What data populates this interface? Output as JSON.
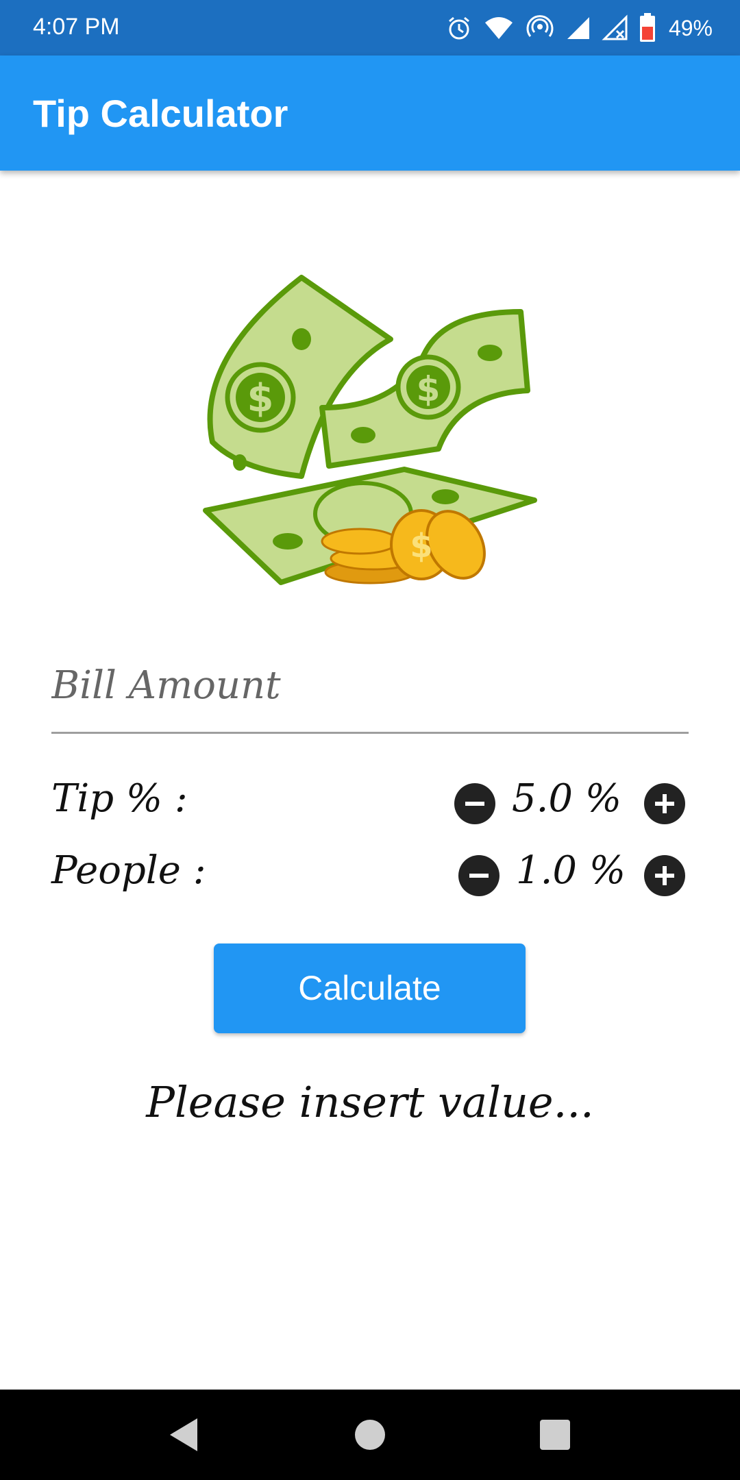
{
  "status_bar": {
    "time": "4:07 PM",
    "battery": "49%",
    "icons": [
      "alarm-icon",
      "wifi-icon",
      "hotspot-icon",
      "signal-icon",
      "signal-no-data-icon",
      "battery-icon"
    ]
  },
  "app_bar": {
    "title": "Tip Calculator"
  },
  "hero": {
    "image": "money-illustration"
  },
  "bill": {
    "placeholder": "Bill Amount",
    "value": ""
  },
  "tip": {
    "label": "Tip % :",
    "value": "5.0 %"
  },
  "people": {
    "label": "People :",
    "value": "1.0 %"
  },
  "calculate": {
    "label": "Calculate"
  },
  "result": {
    "text": "Please insert value..."
  },
  "colors": {
    "status_bar": "#1c6fc0",
    "app_bar": "#2196f3",
    "button": "#2196f3",
    "stepper": "#222222",
    "bill_green": "#c5dc8e",
    "bill_outline": "#5a9a0a",
    "coin": "#f6b91c"
  },
  "nav": {
    "icons": [
      "back-icon",
      "home-icon",
      "recents-icon"
    ]
  }
}
